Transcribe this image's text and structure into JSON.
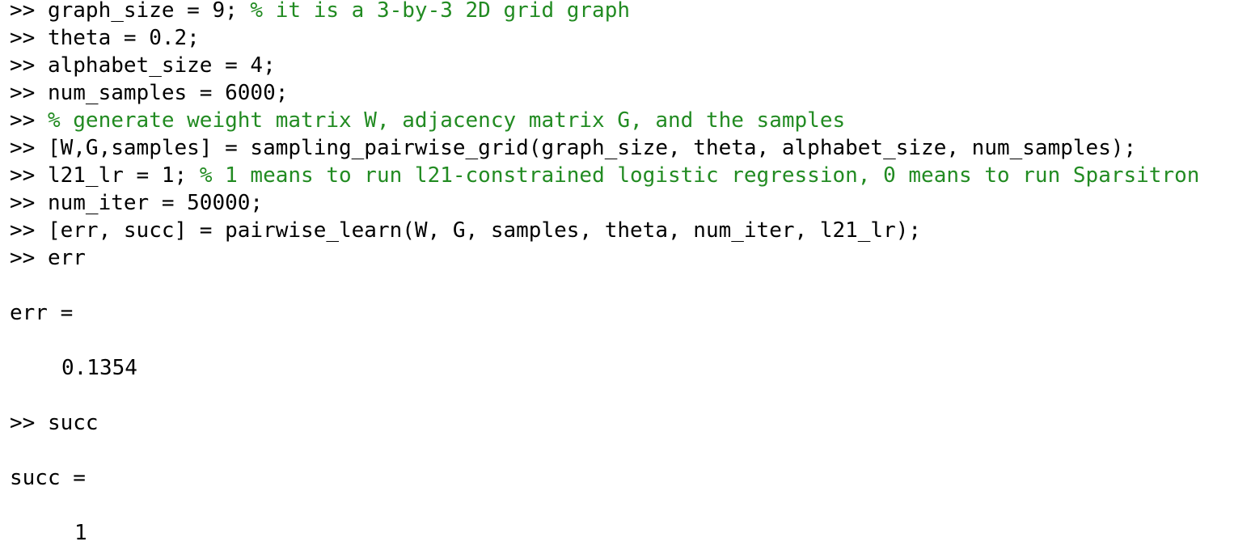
{
  "console": {
    "prompt": ">> ",
    "colors": {
      "text": "#000000",
      "comment": "#228B22",
      "background": "#ffffff"
    },
    "lines": [
      {
        "code": "graph_size = 9; ",
        "comment": "% it is a 3-by-3 2D grid graph"
      },
      {
        "code": "theta = 0.2;",
        "comment": ""
      },
      {
        "code": "alphabet_size = 4;",
        "comment": ""
      },
      {
        "code": "num_samples = 6000;",
        "comment": ""
      },
      {
        "code": "",
        "comment": "% generate weight matrix W, adjacency matrix G, and the samples"
      },
      {
        "code": "[W,G,samples] = sampling_pairwise_grid(graph_size, theta, alphabet_size, num_samples);",
        "comment": ""
      },
      {
        "code": "l21_lr = 1; ",
        "comment": "% 1 means to run l21-constrained logistic regression, 0 means to run Sparsitron"
      },
      {
        "code": "num_iter = 50000;",
        "comment": ""
      },
      {
        "code": "[err, succ] = pairwise_learn(W, G, samples, theta, num_iter, l21_lr);",
        "comment": ""
      },
      {
        "code": "err",
        "comment": ""
      },
      {
        "code": "succ",
        "comment": ""
      }
    ],
    "outputs": {
      "err_label": "err =",
      "err_value": "0.1354",
      "succ_label": "succ =",
      "succ_value": "1"
    }
  }
}
